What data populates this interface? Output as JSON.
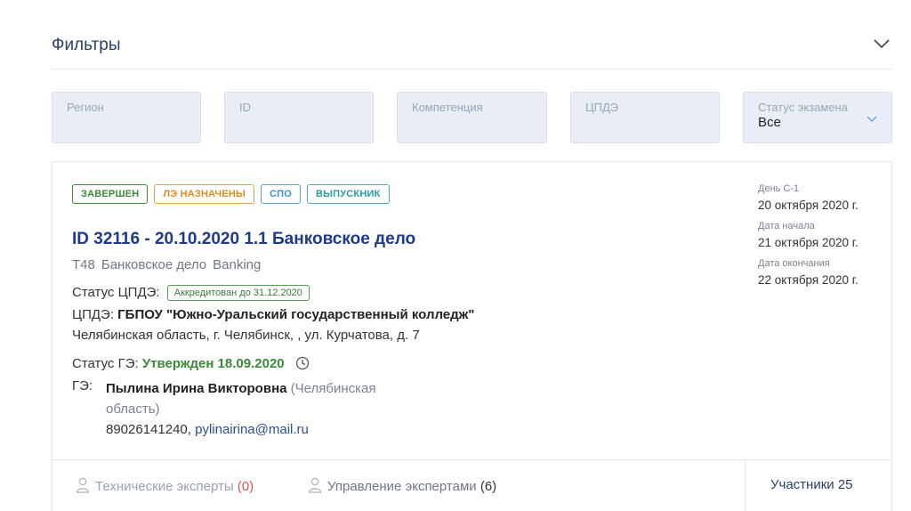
{
  "filters": {
    "title": "Фильтры",
    "fields": [
      {
        "placeholder": "Регион",
        "value": ""
      },
      {
        "placeholder": "ID",
        "value": ""
      },
      {
        "placeholder": "Компетенция",
        "value": ""
      },
      {
        "placeholder": "ЦПДЭ",
        "value": ""
      },
      {
        "placeholder": "Статус экзамена",
        "value": "Все"
      }
    ]
  },
  "exam": {
    "badges": [
      "ЗАВЕРШЕН",
      "ЛЭ НАЗНАЧЕНЫ",
      "СПО",
      "ВЫПУСКНИК"
    ],
    "title": "ID 32116 - 20.10.2020 1.1 Банковское дело",
    "competence_code": "T48",
    "competence_ru": "Банковское дело",
    "competence_en": "Banking",
    "cpde_status_label": "Статус ЦПДЭ:",
    "cpde_status_badge": "Аккредитован до 31.12.2020",
    "cpde_label": "ЦПДЭ:",
    "cpde_name": "ГБПОУ \"Южно-Уральский государственный колледж\"",
    "address": "Челябинская область, г. Челябинск, , ул. Курчатова, д. 7",
    "ge_status_label": "Статус ГЭ:",
    "ge_status_value": "Утвержден 18.09.2020",
    "ge_label": "ГЭ:",
    "ge_name": "Пылина Ирина Викторовна",
    "ge_region": "(Челябинская область)",
    "ge_phone": "89026141240,",
    "ge_email": "pylinairina@mail.ru"
  },
  "dates": [
    {
      "label": "День С-1",
      "value": "20 октября 2020 г."
    },
    {
      "label": "Дата начала",
      "value": "21 октября 2020 г."
    },
    {
      "label": "Дата окончания",
      "value": "22 октября 2020 г."
    }
  ],
  "footer": {
    "tech_label": "Технические эксперты",
    "tech_count": "(0)",
    "mgmt_label": "Управление экспертами",
    "mgmt_count": "(6)",
    "participants": "Участники 25"
  },
  "icons": {
    "chevron": "chevron-down-icon",
    "clock": "clock-icon",
    "user": "user-icon"
  },
  "colors": {
    "title": "#1f3a8a",
    "badge_done": "#3a8a3a",
    "badge_assigned": "#e08a1e",
    "badge_spo": "#3a8ed8",
    "badge_graduate": "#2c9aa6",
    "count_zero": "#e05050"
  }
}
